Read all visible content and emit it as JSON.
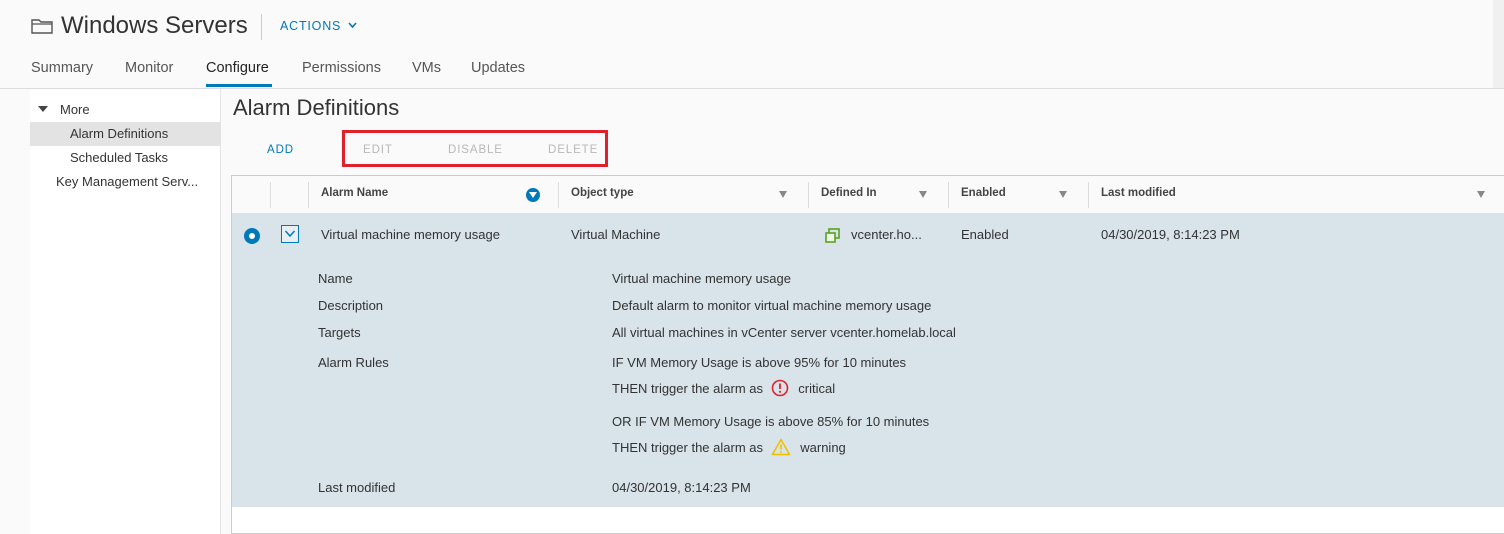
{
  "header": {
    "title": "Windows Servers",
    "actions_label": "ACTIONS",
    "tabs": [
      "Summary",
      "Monitor",
      "Configure",
      "Permissions",
      "VMs",
      "Updates"
    ],
    "active_tab": "Configure"
  },
  "sidebar": {
    "group_label": "More",
    "items": [
      "Alarm Definitions",
      "Scheduled Tasks",
      "Key Management Serv..."
    ],
    "selected": "Alarm Definitions"
  },
  "main": {
    "title": "Alarm Definitions",
    "toolbar": {
      "add": "ADD",
      "edit": "EDIT",
      "disable": "DISABLE",
      "delete": "DELETE"
    }
  },
  "grid": {
    "columns": [
      "Alarm Name",
      "Object type",
      "Defined In",
      "Enabled",
      "Last modified"
    ],
    "row": {
      "alarm_name": "Virtual machine memory usage",
      "object_type": "Virtual Machine",
      "defined_in": "vcenter.ho...",
      "enabled": "Enabled",
      "last_modified": "04/30/2019, 8:14:23 PM"
    },
    "details": {
      "name_label": "Name",
      "name_value": "Virtual machine memory usage",
      "description_label": "Description",
      "description_value": "Default alarm to monitor virtual machine memory usage",
      "targets_label": "Targets",
      "targets_value": "All virtual machines in vCenter server vcenter.homelab.local",
      "rules_label": "Alarm Rules",
      "rule1_if": "IF VM Memory Usage is above 95% for 10 minutes",
      "rule1_then": "THEN trigger the alarm as",
      "rule1_severity": "critical",
      "rule2_if": "OR IF VM Memory Usage is above 85% for 10 minutes",
      "rule2_then": "THEN trigger the alarm as",
      "rule2_severity": "warning",
      "last_modified_label": "Last modified",
      "last_modified_value": "04/30/2019, 8:14:23 PM"
    }
  },
  "colors": {
    "accent": "#0079b8",
    "highlight_box": "#e0202b",
    "critical": "#e0202b",
    "warning": "#f0c000",
    "selected_row": "#d8e3ea"
  }
}
